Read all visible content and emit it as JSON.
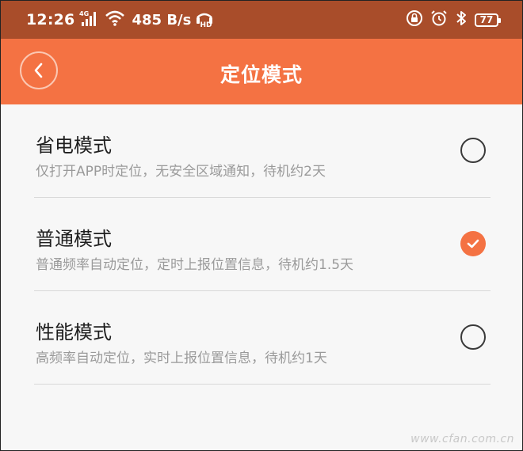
{
  "status_bar": {
    "time": "12:26",
    "network_type": "4G",
    "net_speed": "485 B/s",
    "hd_label": "HD",
    "battery_level": "77",
    "icons": [
      "signal-icon",
      "wifi-icon",
      "hd-call-icon",
      "rotation-lock-icon",
      "alarm-icon",
      "bluetooth-icon",
      "battery-icon"
    ]
  },
  "header": {
    "title": "定位模式",
    "back_icon": "back-chevron-icon"
  },
  "modes": [
    {
      "title": "省电模式",
      "description": "仅打开APP时定位，无安全区域通知，待机约2天",
      "selected": false
    },
    {
      "title": "普通模式",
      "description": "普通频率自动定位，定时上报位置信息，待机约1.5天",
      "selected": true
    },
    {
      "title": "性能模式",
      "description": "高频率自动定位，实时上报位置信息，待机约1天",
      "selected": false
    }
  ],
  "watermark": "www.cfan.com.cn",
  "colors": {
    "status_bar_bg": "#a94d2a",
    "accent": "#f47243",
    "background": "#f7f7f7",
    "title_text": "#1e1e1e",
    "desc_text": "#9a9a9a"
  }
}
